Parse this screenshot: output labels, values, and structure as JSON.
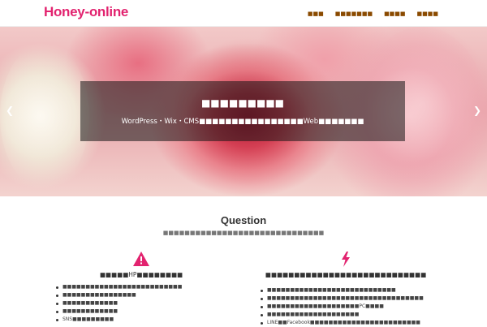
{
  "header": {
    "logo": "Honey-online",
    "nav": [
      "■■■",
      "■■■■■■■",
      "■■■■",
      "■■■■"
    ]
  },
  "hero": {
    "title": "■■■■■■■■■",
    "subtitle": "WordPress・Wix・CMS■■■■■■■■■■■■■■■■Web■■■■■■■"
  },
  "section": {
    "title": "Question",
    "subtitle": "■■■■■■■■■■■■■■■■■■■■■■■■■■■■■■"
  },
  "columns": [
    {
      "icon": "warning-icon",
      "heading": "■■■■■HP■■■■■■■■",
      "items": [
        "■■■■■■■■■■■■■■■■■■■■■■■■■■",
        "■■■■■■■■■■■■■■■■",
        "■■■■■■■■■■■■",
        "■■■■■■■■■■■■",
        "SNS■■■■■■■■■"
      ]
    },
    {
      "icon": "lightning-icon",
      "heading": "■■■■■■■■■■■■■■■■■■■■■■■■■■■■",
      "items": [
        "■■■■■■■■■■■■■■■■■■■■■■■■■■■■",
        "■■■■■■■■■■■■■■■■■■■■■■■■■■■■■■■■■■",
        "■■■■■■■■■■■■■■■■■■■■PC■■■■",
        "■■■■■■■■■■■■■■■■■■■■",
        "LINE■■Facebook■■■■■■■■■■■■■■■■■■■■■■■■"
      ]
    }
  ],
  "colors": {
    "brand": "#e2236f",
    "nav_text": "#8a4a00"
  }
}
